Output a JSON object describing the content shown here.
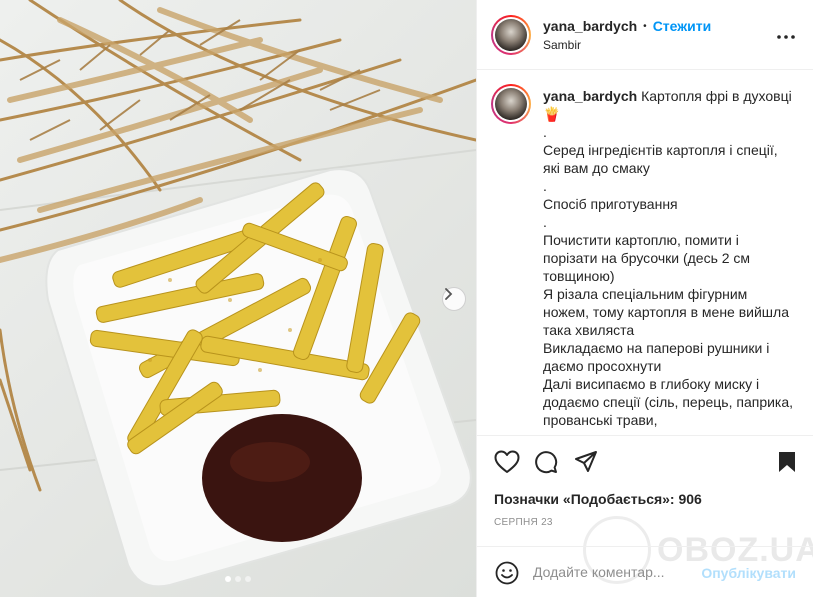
{
  "post": {
    "username": "yana_bardych",
    "separator": "•",
    "follow_label": "Стежити",
    "location": "Sambir",
    "caption_lines": [
      "Картопля фрі в духовці🍟",
      ".",
      "Серед інгредієнтів картопля і спеції, які вам до смаку",
      ".",
      "Спосіб приготування",
      ".",
      "Почистити картоплю, помити і порізати на брусочки (десь 2 см товщиною)",
      "Я різала спеціальним фігурним ножем, тому картопля в мене вийшла така хвиляста",
      "Викладаємо на паперові рушники і даємо просохнути",
      "Далі висипаємо в глибоку миску і додаємо спеції (сіль, перець, паприка, прованські трави,"
    ],
    "likes_text": "Позначки «Подобається»: 906",
    "date": "СЕРПНЯ 23",
    "comment_placeholder": "Додайте коментар...",
    "publish_label": "Опублікувати",
    "carousel": {
      "count": 3,
      "active": 0
    }
  },
  "icons": {
    "more": "more-options-icon",
    "like": "heart-icon",
    "comment": "comment-icon",
    "share": "share-icon",
    "save": "bookmark-icon",
    "emoji": "emoji-icon",
    "next": "chevron-right-icon"
  },
  "watermark": "OBOZ.UA",
  "colors": {
    "accent": "#0095f6",
    "publish_disabled": "#b2dffc",
    "text": "#262626",
    "muted": "#8e8e8e",
    "border": "#efefef"
  }
}
